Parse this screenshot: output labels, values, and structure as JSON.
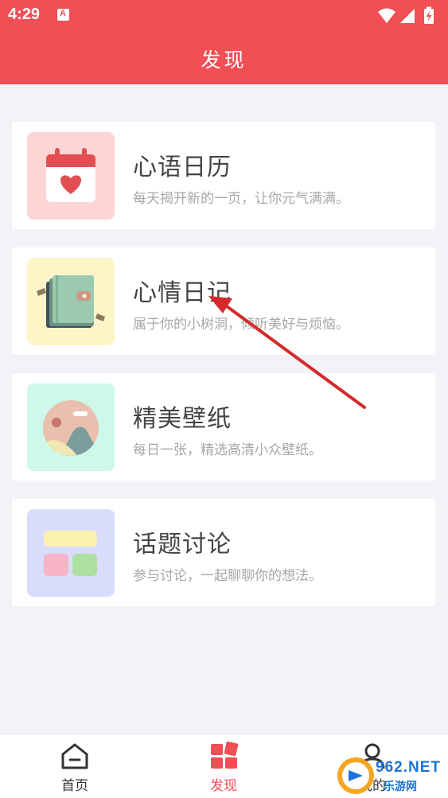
{
  "status_bar": {
    "time": "4:29",
    "app_icon": "app-notification-icon",
    "icons": [
      "wifi-icon",
      "signal-icon",
      "battery-charging-icon"
    ]
  },
  "header": {
    "title": "发现"
  },
  "cards": [
    {
      "title": "心语日历",
      "description": "每天揭开新的一页，让你元气满满。",
      "icon": "calendar-heart-icon",
      "icon_bg": "#fdd5d5"
    },
    {
      "title": "心情日记",
      "description": "属于你的小树洞，倾听美好与烦恼。",
      "icon": "diary-book-icon",
      "icon_bg": "#fdf5c8"
    },
    {
      "title": "精美壁纸",
      "description": "每日一张，精选高清小众壁纸。",
      "icon": "wallpaper-landscape-icon",
      "icon_bg": "#cdf8ea"
    },
    {
      "title": "话题讨论",
      "description": "参与讨论，一起聊聊你的想法。",
      "icon": "topic-blocks-icon",
      "icon_bg": "#dadcfb"
    }
  ],
  "tab_bar": {
    "tabs": [
      {
        "label": "首页",
        "icon": "home-icon",
        "active": false
      },
      {
        "label": "发现",
        "icon": "discover-grid-icon",
        "active": true
      },
      {
        "label": "我的",
        "icon": "profile-icon",
        "active": false
      }
    ]
  },
  "watermark": {
    "text": "962.NET",
    "subtext": "乐游网"
  },
  "colors": {
    "primary": "#f04f55",
    "background": "#f3f3f7",
    "annotation_arrow": "#d42a2a"
  }
}
